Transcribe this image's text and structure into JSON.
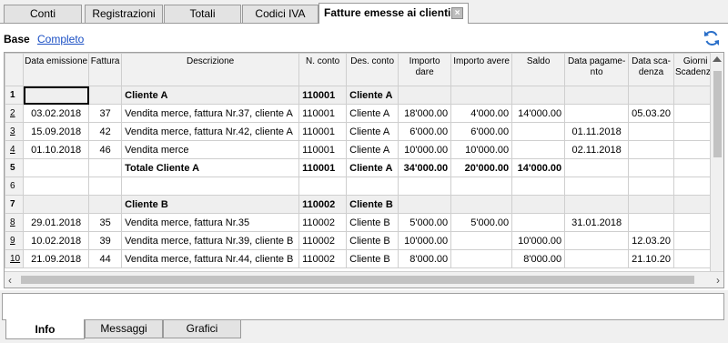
{
  "tabs": [
    {
      "label": "Conti"
    },
    {
      "label": "Registrazioni"
    },
    {
      "label": "Totali"
    },
    {
      "label": "Codici IVA"
    },
    {
      "label": "Fatture emesse ai clienti"
    }
  ],
  "views": {
    "base": "Base",
    "completo": "Completo"
  },
  "columns": [
    "Data emissione",
    "Fattura",
    "Descrizione",
    "N. conto",
    "Des. conto",
    "Importo dare",
    "Importo avere",
    "Saldo",
    "Data pagame-nto",
    "Data sca-denza",
    "Giorni Scadenza"
  ],
  "rows": [
    {
      "n": "1",
      "data": "",
      "fattura": "",
      "desc": "Cliente A",
      "conto": "110001",
      "desconto": "Cliente A",
      "dare": "",
      "avere": "",
      "saldo": "",
      "pag": "",
      "scad": "",
      "giorni": ""
    },
    {
      "n": "2",
      "data": "03.02.2018",
      "fattura": "37",
      "desc": "Vendita merce, fattura Nr.37, cliente A",
      "conto": "110001",
      "desconto": "Cliente A",
      "dare": "18'000.00",
      "avere": "4'000.00",
      "saldo": "14'000.00",
      "pag": "",
      "scad": "05.03.20",
      "giorni": ""
    },
    {
      "n": "3",
      "data": "15.09.2018",
      "fattura": "42",
      "desc": "Vendita merce, fattura Nr.42, cliente A",
      "conto": "110001",
      "desconto": "Cliente A",
      "dare": "6'000.00",
      "avere": "6'000.00",
      "saldo": "",
      "pag": "01.11.2018",
      "scad": "",
      "giorni": ""
    },
    {
      "n": "4",
      "data": "01.10.2018",
      "fattura": "46",
      "desc": "Vendita merce",
      "conto": "110001",
      "desconto": "Cliente A",
      "dare": "10'000.00",
      "avere": "10'000.00",
      "saldo": "",
      "pag": "02.11.2018",
      "scad": "",
      "giorni": ""
    },
    {
      "n": "5",
      "data": "",
      "fattura": "",
      "desc": "Totale Cliente A",
      "conto": "110001",
      "desconto": "Cliente A",
      "dare": "34'000.00",
      "avere": "20'000.00",
      "saldo": "14'000.00",
      "pag": "",
      "scad": "",
      "giorni": ""
    },
    {
      "n": "6",
      "data": "",
      "fattura": "",
      "desc": "",
      "conto": "",
      "desconto": "",
      "dare": "",
      "avere": "",
      "saldo": "",
      "pag": "",
      "scad": "",
      "giorni": ""
    },
    {
      "n": "7",
      "data": "",
      "fattura": "",
      "desc": "Cliente B",
      "conto": "110002",
      "desconto": "Cliente B",
      "dare": "",
      "avere": "",
      "saldo": "",
      "pag": "",
      "scad": "",
      "giorni": ""
    },
    {
      "n": "8",
      "data": "29.01.2018",
      "fattura": "35",
      "desc": "Vendita merce, fattura Nr.35",
      "conto": "110002",
      "desconto": "Cliente B",
      "dare": "5'000.00",
      "avere": "5'000.00",
      "saldo": "",
      "pag": "31.01.2018",
      "scad": "",
      "giorni": ""
    },
    {
      "n": "9",
      "data": "10.02.2018",
      "fattura": "39",
      "desc": "Vendita merce, fattura Nr.39, cliente B",
      "conto": "110002",
      "desconto": "Cliente B",
      "dare": "10'000.00",
      "avere": "",
      "saldo": "10'000.00",
      "pag": "",
      "scad": "12.03.20",
      "giorni": ""
    },
    {
      "n": "10",
      "data": "21.09.2018",
      "fattura": "44",
      "desc": "Vendita merce, fattura Nr.44, cliente B",
      "conto": "110002",
      "desconto": "Cliente B",
      "dare": "8'000.00",
      "avere": "",
      "saldo": "8'000.00",
      "pag": "",
      "scad": "21.10.20",
      "giorni": ""
    }
  ],
  "bottom_tabs": [
    {
      "label": "Info"
    },
    {
      "label": "Messaggi"
    },
    {
      "label": "Grafici"
    }
  ]
}
